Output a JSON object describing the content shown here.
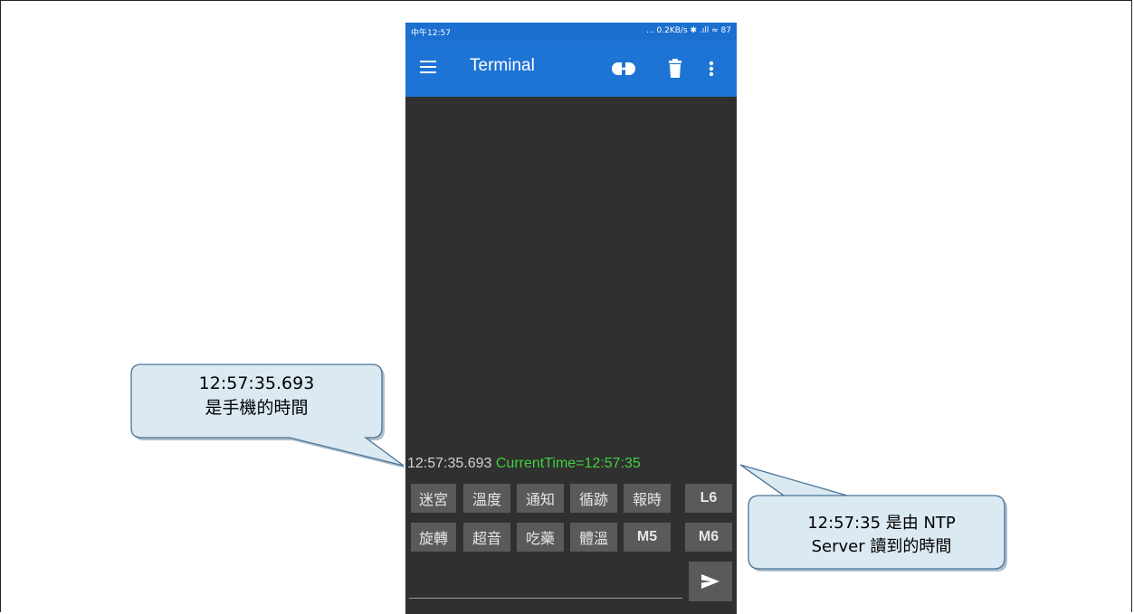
{
  "status_bar": {
    "time": "中午12:57",
    "indicators": "... 0.2KB/s ✱ .ıll ≈ 87"
  },
  "app_bar": {
    "title": "Terminal",
    "icons": [
      "menu-icon",
      "connect-icon",
      "trash-icon",
      "more-vert-icon"
    ]
  },
  "terminal": {
    "timestamp": "12:57:35.693",
    "message": "CurrentTime=12:57:35"
  },
  "macro_buttons": {
    "row1": [
      "迷宮",
      "溫度",
      "通知",
      "循跡",
      "報時",
      "L6"
    ],
    "row2": [
      "旋轉",
      "超音",
      "吃藥",
      "體溫",
      "M5",
      "M6"
    ]
  },
  "send_icon": "send-icon",
  "callout_left": {
    "line1": "12:57:35.693",
    "line2": "是手機的時間"
  },
  "callout_right": {
    "line1": "12:57:35 是由 NTP",
    "line2": "Server 讀到的時間"
  },
  "colors": {
    "app_bar": "#1e74d4",
    "terminal_bg": "#303030",
    "message_green": "#40d040",
    "callout_fill": "#dbe9f3",
    "callout_border": "#4a7396"
  }
}
